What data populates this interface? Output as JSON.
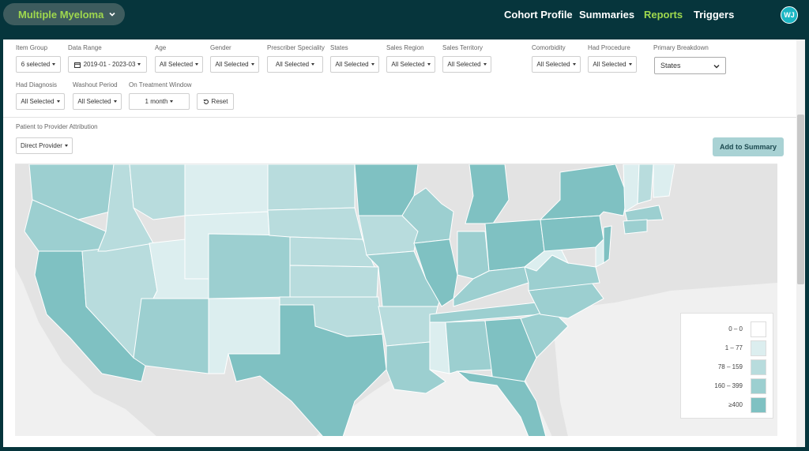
{
  "header": {
    "cohort": "Multiple Myeloma",
    "nav": [
      "Cohort Profile",
      "Summaries",
      "Reports",
      "Triggers"
    ],
    "active_nav": "Reports",
    "avatar_initials": "WJ"
  },
  "filters": {
    "row1": [
      {
        "label": "Item Group",
        "value": "6 selected"
      },
      {
        "label": "Data Range",
        "value": "2019-01 - 2023-03"
      },
      {
        "label": "Age",
        "value": "All Selected"
      },
      {
        "label": "Gender",
        "value": "All Selected"
      },
      {
        "label": "Prescriber Speciality",
        "value": "All Selected"
      },
      {
        "label": "States",
        "value": "All Selected"
      },
      {
        "label": "Sales Region",
        "value": "All Selected"
      },
      {
        "label": "Sales Territory",
        "value": "All Selected"
      },
      {
        "label": "Comorbidity",
        "value": "All Selected"
      },
      {
        "label": "Had Procedure",
        "value": "All Selected"
      }
    ],
    "primary_breakdown": {
      "label": "Primary Breakdown",
      "value": "States"
    },
    "row2": [
      {
        "label": "Had Diagnosis",
        "value": "All Selected"
      },
      {
        "label": "Washout Period",
        "value": "All Selected"
      },
      {
        "label": "On Treatment Window",
        "value": "1 month"
      }
    ],
    "reset_label": "Reset",
    "attribution": {
      "label": "Patient to Provider Attribution",
      "value": "Direct Provider"
    },
    "add_summary_label": "Add to Summary"
  },
  "legend": {
    "items": [
      {
        "range": "0 – 0",
        "color": "#ffffff"
      },
      {
        "range": "1 – 77",
        "color": "#dceeef"
      },
      {
        "range": "78 – 159",
        "color": "#b8dcdd"
      },
      {
        "range": "160 – 399",
        "color": "#9ccfd0"
      },
      {
        "range": "≥400",
        "color": "#7fc1c2"
      }
    ]
  },
  "colors": {
    "background": "#06353c",
    "accent": "#9fd84e",
    "avatar": "#1cb6c4",
    "map_land": "#e3e3e3"
  }
}
